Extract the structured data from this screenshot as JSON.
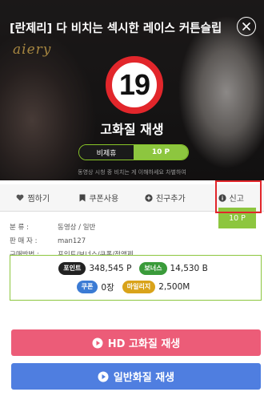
{
  "video": {
    "title": "[란제리] 다 비치는 섹시한 레이스 커튼슬립",
    "logo_text": "aiery",
    "age_rating": "19",
    "quality_label": "고화질 재생",
    "price_pill": {
      "left": "비제휴",
      "right": "10 P"
    },
    "notice": "동영상 시청 중 비치는 게 이해하세요 차별하여"
  },
  "actions": [
    {
      "icon": "heart-icon",
      "label": "찜하기"
    },
    {
      "icon": "bookmark-icon",
      "label": "쿠폰사용"
    },
    {
      "icon": "plus-circle-icon",
      "label": "친구추가"
    },
    {
      "icon": "info-circle-icon",
      "label": "신고"
    }
  ],
  "info": {
    "category_key": "분    류 :",
    "category_val": "동영상 / 일반",
    "seller_key": "판 매 자 :",
    "seller_val": "man127",
    "method_key": "구매방법 :",
    "method_val": "포인트/보너스/쿠폰/정액제"
  },
  "buy_button": "10 P",
  "balance": {
    "point_label": "포인트",
    "point_value": "348,545 P",
    "bonus_label": "보너스",
    "bonus_value": "14,530 B",
    "coupon_label": "쿠폰",
    "coupon_value": "0장",
    "mileage_label": "마일리지",
    "mileage_value": "2,500M"
  },
  "buttons": {
    "hd_play": "HD 고화질 재생",
    "normal_play": "일반화질 재생"
  },
  "colors": {
    "accent_green": "#8dc63f",
    "hd_pink": "#ec5c78",
    "normal_blue": "#4f7ee0",
    "badge_red": "#e2262b"
  }
}
